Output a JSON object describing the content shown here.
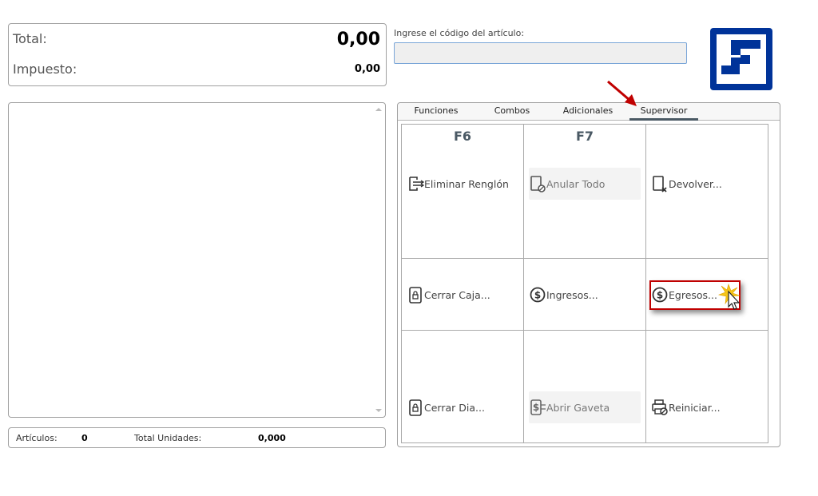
{
  "totals": {
    "total_label": "Total:",
    "total_value": "0,00",
    "tax_label": "Impuesto:",
    "tax_value": "0,00"
  },
  "code_input": {
    "label": "Ingrese el código del artículo:",
    "value": ""
  },
  "footer": {
    "articles_label": "Artículos:",
    "articles_value": "0",
    "units_label": "Total Unidades:",
    "units_value": "0,000"
  },
  "tabs": [
    {
      "label": "Funciones"
    },
    {
      "label": "Combos"
    },
    {
      "label": "Adicionales"
    },
    {
      "label": "Supervisor",
      "active": true
    }
  ],
  "grid": {
    "fkeys": [
      "F6",
      "F7"
    ],
    "buttons": [
      {
        "label": "Eliminar Renglón",
        "icon": "delete-row-icon"
      },
      {
        "label": "Anular Todo",
        "icon": "cancel-all-icon",
        "disabled": true
      },
      {
        "label": "Devolver...",
        "icon": "return-icon"
      },
      {
        "label": "Cerrar Caja...",
        "icon": "lock-icon"
      },
      {
        "label": "Ingresos...",
        "icon": "dollar-icon"
      },
      {
        "label": "Egresos...",
        "icon": "dollar-icon"
      },
      {
        "label": "Cerrar Dia...",
        "icon": "lock-icon"
      },
      {
        "label": "Abrir Gaveta",
        "icon": "cash-drawer-icon",
        "disabled": true
      },
      {
        "label": "Reiniciar...",
        "icon": "printer-reset-icon"
      }
    ]
  },
  "colors": {
    "brand": "#003399",
    "highlight": "#c00000",
    "tab_underline": "#4a5964"
  }
}
